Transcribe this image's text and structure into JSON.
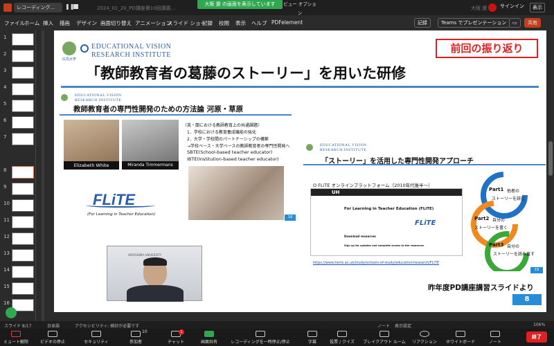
{
  "window": {
    "title": "レコーディング...",
    "filename": "2024_01_20_PD講座第10回講義...",
    "share_banner": "大阪 遼 の画面を表示しています",
    "view_options": "ビュー オプション",
    "user_name": "大阪 遼",
    "signin": "サインイン",
    "display": "表示"
  },
  "ribbon": {
    "tabs": [
      "ファイル",
      "ホーム",
      "挿入",
      "描画",
      "デザイン",
      "画面切り替え",
      "アニメーション",
      "スライド ショー",
      "記録",
      "校閲",
      "表示",
      "ヘルプ",
      "PDFelement"
    ],
    "record": "記録",
    "teams": "Teams でプレゼンテーション",
    "share": "共有"
  },
  "thumbnails": [
    "1",
    "2",
    "3",
    "4",
    "5",
    "6",
    "7",
    "8",
    "9",
    "10",
    "11",
    "12",
    "13",
    "14",
    "15",
    "16"
  ],
  "slide": {
    "org_line1": "EDUCATIONAL VISION",
    "org_line2": "RESEARCH INSTITUTE",
    "uni_small": "広島大学",
    "review_badge": "前回の振り返り",
    "main_title": "「教師教育者の葛藤のストーリー」を用いた研修",
    "left": {
      "title": "教師教育者の専門性開発のための方法論 河原・草原",
      "person1": "Elizabeth White",
      "person2": "Miranda Timmermans",
      "issues_title": "〈英・蘭における教師教育上の共通課題〉",
      "issues": [
        "1．学校における教育養成機能の強化",
        "2．大学・学校間のパートナーシップの構築",
        "→学校ベース・大学ベースの教師教育者の専門性開発へ",
        "SBTE(School-based teacher educator)",
        "IBTE(Institution-based teacher educator)"
      ],
      "flite": "FLiTE",
      "flite_sub": "(For Learning in Teacher Education)",
      "page": "18"
    },
    "webcam": {
      "label": "HIROSHIMA UNIVERSITY"
    },
    "right": {
      "title": "「ストーリー」を活用した専門性開発アプローチ",
      "platform": "O FLiTE オンラインプラットフォーム（2010年代後半～）",
      "site_heading": "For Learning in Teacher Education (FLiTE)",
      "site_brand": "UH",
      "download_heading": "Download resources",
      "signup_heading": "Sign up for updates and complete access to the resources",
      "url": "https://www.herts.ac.uk/study/schools-of-study/education/research/FLiTE",
      "parts": [
        {
          "num": "Part1",
          "line1": "他者の",
          "line2": "ストーリーを読む"
        },
        {
          "num": "Part2",
          "line1": "自分の",
          "line2": "ストーリーを書く"
        },
        {
          "num": "Part3",
          "line1": "自分の",
          "line2": "ストーリーを読み直す"
        }
      ],
      "page": "19"
    },
    "footer": "昨年度PD講座講習スライドより",
    "page_num": "8"
  },
  "status": {
    "slide": "スライド 8/17",
    "lang": "日本語",
    "access": "アクセシビリティ: 検討が必要です",
    "notes": "ノート",
    "view": "表示設定",
    "zoom": "106%"
  },
  "zoom": {
    "items": [
      "ミュート解除",
      "ビデオの停止",
      "セキュリティ",
      "参加者",
      "チャット",
      "画面共有",
      "レコーディングを一時停止/停止",
      "字幕",
      "投票 / クイズ",
      "ブレイクアウト ルーム",
      "リアクション",
      "ホワイトボード",
      "ノート"
    ],
    "participants_count": "10",
    "chat_badge": "1",
    "end": "終了"
  }
}
